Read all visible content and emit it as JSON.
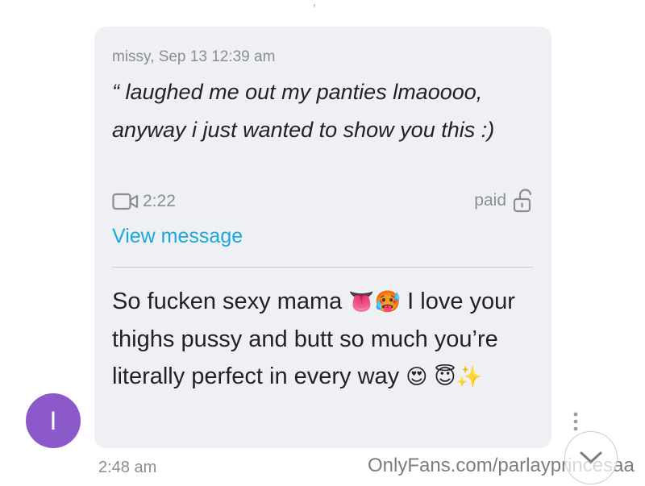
{
  "quoted_message": {
    "meta": "missy, Sep 13 12:39 am",
    "text": "“ laughed me out my panties lmaoooo, anyway i just wanted to show you this :)",
    "video_duration": "2:22",
    "status": "paid",
    "view_link": "View message"
  },
  "message": {
    "text_part1": "So fucken sexy mama",
    "emoji_1": "👅🥵",
    "text_part2": "I love your thighs pussy and butt so much you’re literally perfect in every way",
    "emoji_2": "😍",
    "emoji_3": "😇✨",
    "time": "2:48 am"
  },
  "avatar": {
    "initial": "I",
    "color": "#8b59c9"
  },
  "watermark": "OnlyFans.com/parlayprincesaa",
  "colors": {
    "bubble": "#eef0f3",
    "link": "#1aa8de",
    "muted": "#8a8d91"
  },
  "icons": {
    "video": "video-camera-icon",
    "lock": "unlocked-lock-icon",
    "more": "more-vertical-icon",
    "scroll": "chevron-down-icon"
  }
}
